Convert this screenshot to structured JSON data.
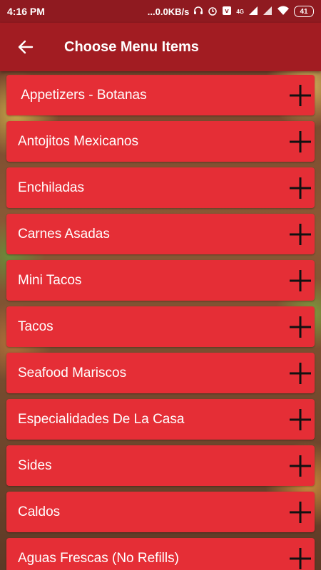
{
  "status_bar": {
    "time": "4:16 PM",
    "network_speed": "...0.0KB/s",
    "network_type": "4G",
    "battery": "41",
    "icons": [
      "headset-icon",
      "alarm-icon",
      "volte-icon",
      "signal-icon",
      "signal-icon",
      "wifi-icon",
      "battery-icon"
    ]
  },
  "app_bar": {
    "back_icon": "arrow-left-icon",
    "title": "Choose Menu Items"
  },
  "menu": {
    "add_icon": "plus-icon",
    "items": [
      {
        "label": " Appetizers - Botanas"
      },
      {
        "label": "Antojitos Mexicanos"
      },
      {
        "label": "Enchiladas"
      },
      {
        "label": "Carnes Asadas"
      },
      {
        "label": "Mini Tacos"
      },
      {
        "label": "Tacos"
      },
      {
        "label": "Seafood Mariscos"
      },
      {
        "label": "Especialidades De La Casa"
      },
      {
        "label": "Sides"
      },
      {
        "label": "Caldos"
      },
      {
        "label": "Aguas Frescas (No Refills)"
      }
    ]
  },
  "colors": {
    "status_bar": "#8f1a20",
    "app_bar": "#a21c22",
    "item_bg": "#e52e36",
    "text": "#ffffff",
    "plus": "#111111"
  }
}
